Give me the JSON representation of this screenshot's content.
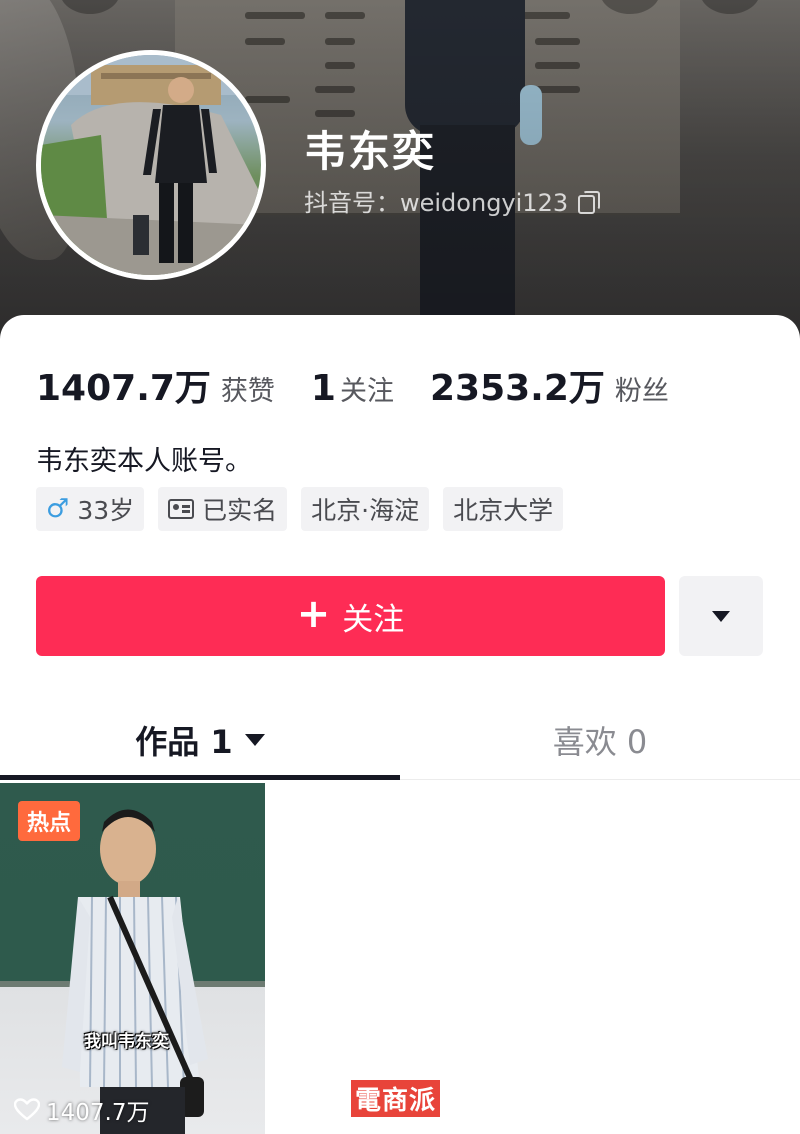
{
  "profile": {
    "name": "韦东奕",
    "douyin_id": "抖音号：weidongyi123",
    "bio": "韦东奕本人账号。"
  },
  "stats": {
    "likes_value": "1407.7万",
    "likes_label": "获赞",
    "following_value": "1",
    "following_label": "关注",
    "followers_value": "2353.2万",
    "followers_label": "粉丝"
  },
  "tags": {
    "age": "33岁",
    "verified": "已实名",
    "location": "北京·海淀",
    "school": "北京大学"
  },
  "actions": {
    "follow_label": "关注"
  },
  "tabs": {
    "works": "作品 1",
    "likes": "喜欢 0"
  },
  "videos": [
    {
      "badge": "热点",
      "caption": "我叫韦东奕",
      "likes": "1407.7万"
    }
  ],
  "watermark": "電商派",
  "colors": {
    "accent": "#fe2c55",
    "hot_badge": "#ff6a3d",
    "male_icon": "#3c9de0"
  },
  "icons": {
    "male": "male-symbol-icon",
    "verified": "id-card-icon",
    "copy": "copy-icon",
    "dropdown": "caret-down-icon",
    "heart": "heart-outline-icon",
    "plus": "plus-icon"
  }
}
